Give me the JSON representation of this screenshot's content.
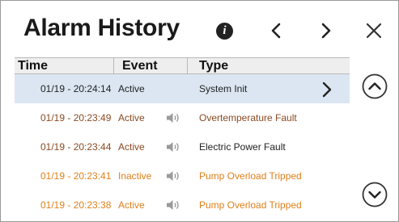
{
  "header": {
    "title": "Alarm History"
  },
  "table": {
    "columns": {
      "time": "Time",
      "event": "Event",
      "type": "Type"
    },
    "rows": [
      {
        "time": "01/19 - 20:24:14",
        "event": "Active",
        "type": "System Init"
      },
      {
        "time": "01/19 - 20:23:49",
        "event": "Active",
        "type": "Overtemperature Fault"
      },
      {
        "time": "01/19 - 20:23:44",
        "event": "Active",
        "type": "Electric Power Fault"
      },
      {
        "time": "01/19 - 20:23:41",
        "event": "Inactive",
        "type": "Pump Overload Tripped"
      },
      {
        "time": "01/19 - 20:23:38",
        "event": "Active",
        "type": "Pump Overload Tripped"
      }
    ]
  },
  "colors": {
    "selected_row": "#dbe6f2",
    "active_alarm_text": "#8a4a22",
    "inactive_alarm_text": "#e0801a",
    "header_bg": "#eeeeee"
  },
  "icons": {
    "info": "info-icon",
    "prev": "chevron-left-icon",
    "next": "chevron-right-icon",
    "close": "close-icon",
    "speaker": "speaker-icon",
    "row_arrow": "chevron-right-icon",
    "scroll_up": "chevron-up-circle-icon",
    "scroll_down": "chevron-down-circle-icon"
  }
}
